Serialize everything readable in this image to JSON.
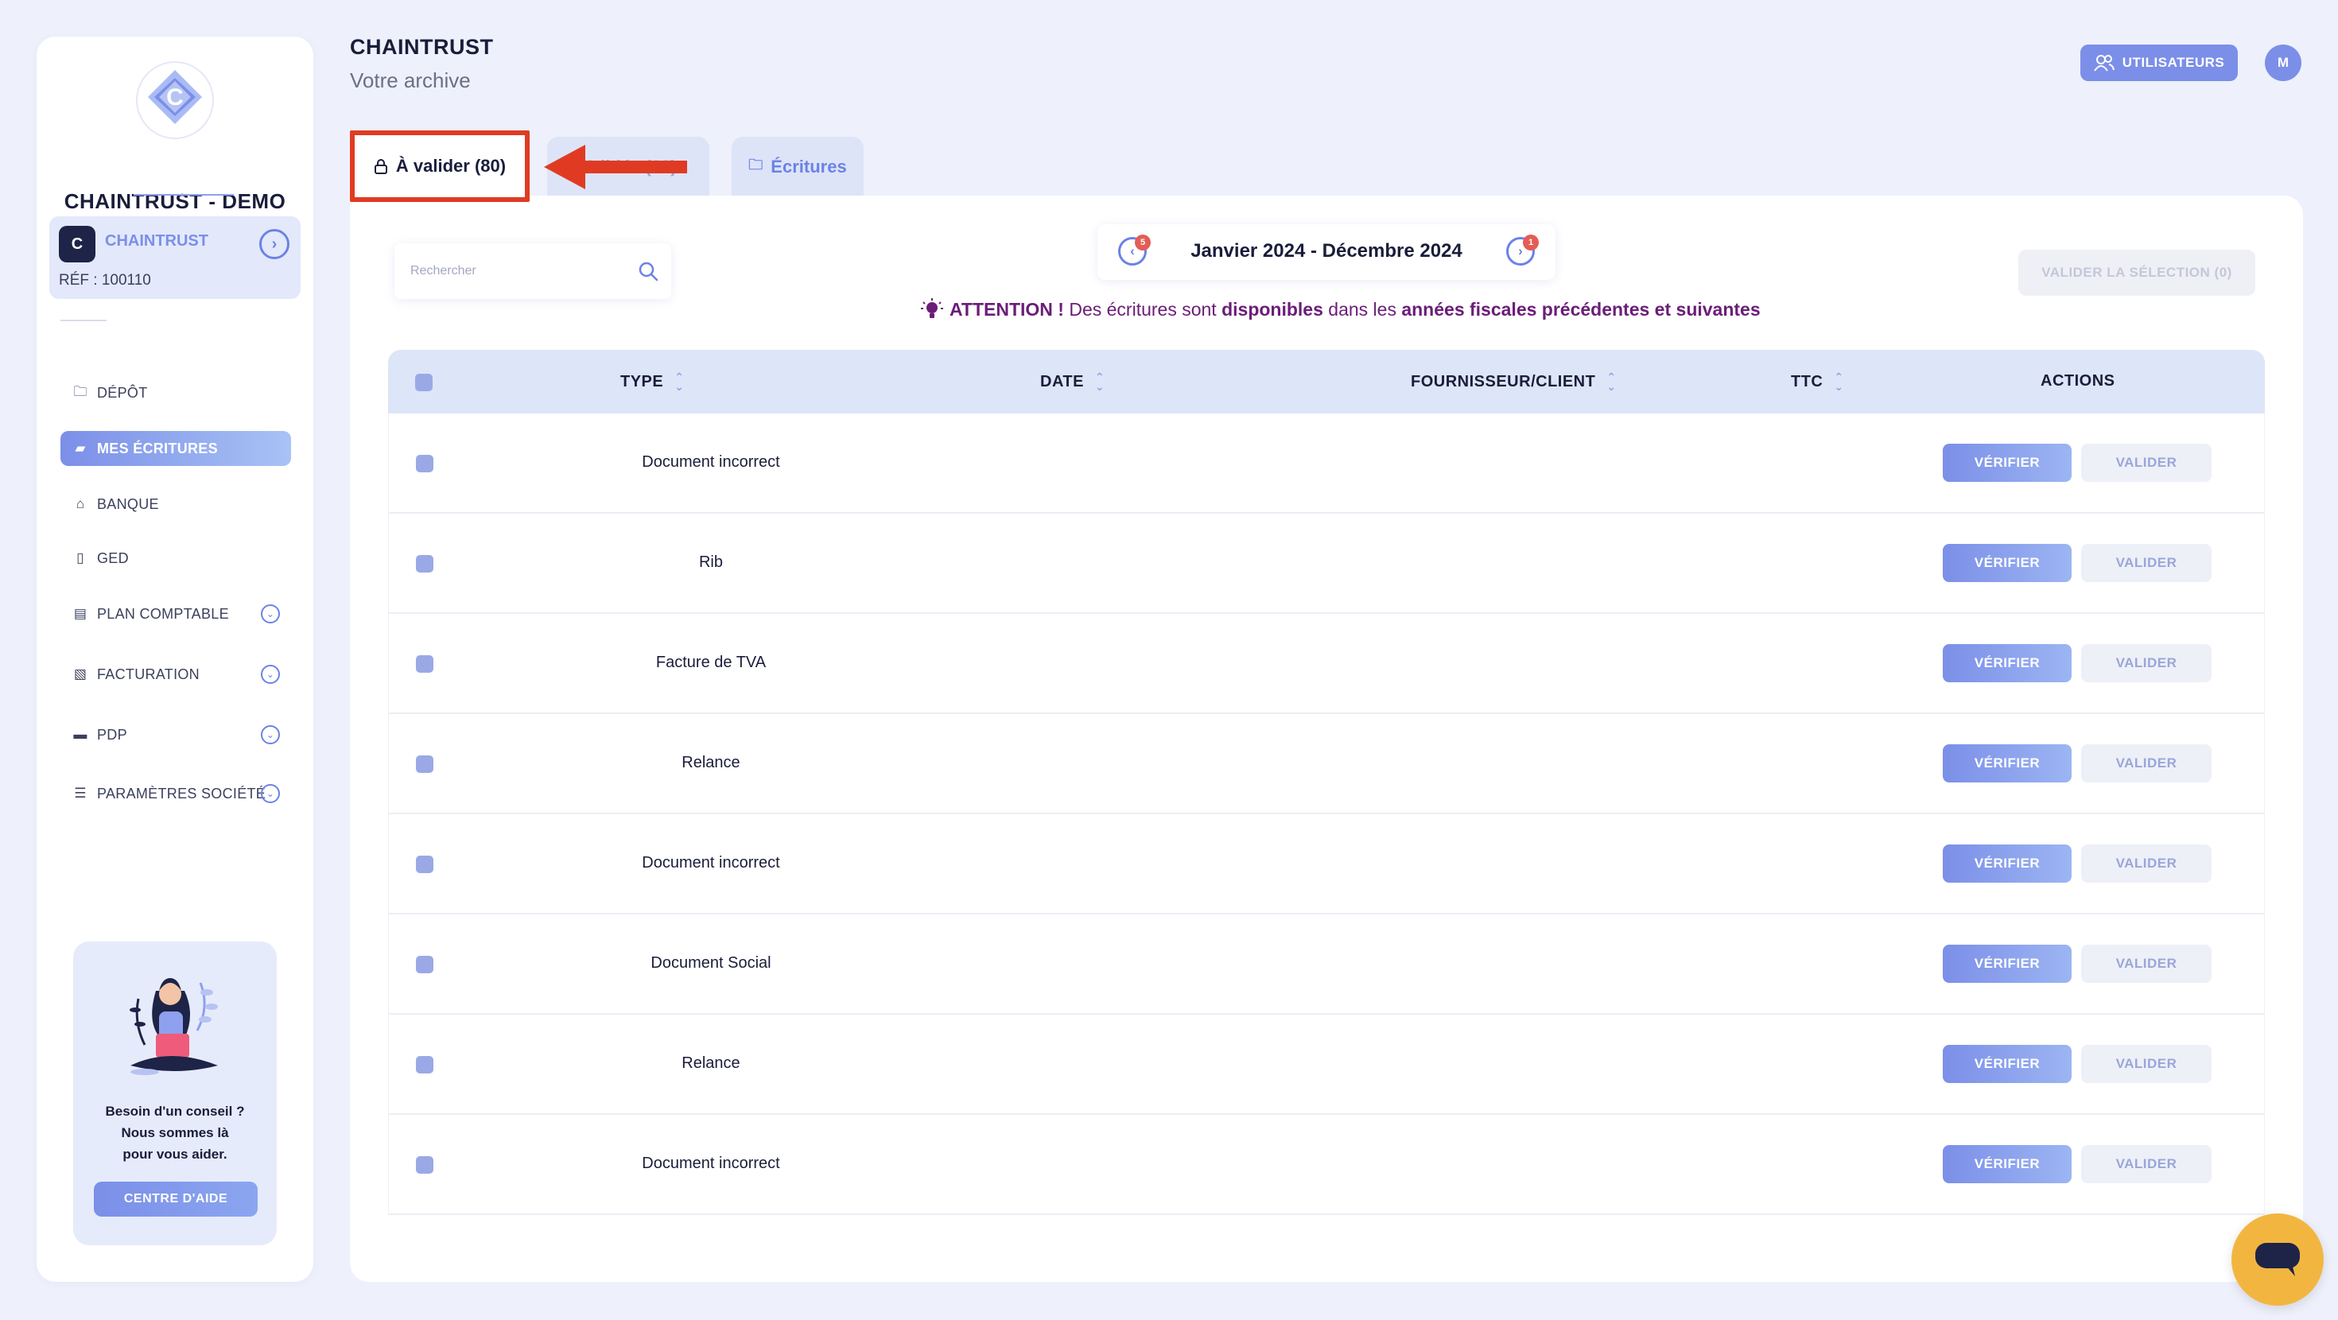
{
  "sidebar": {
    "company_name": "CHAINTRUST - DEMO",
    "company_card": {
      "icon_letter": "C",
      "name": "CHAINTRUST",
      "ref": "RÉF : 100110"
    },
    "nav": [
      {
        "label": "DÉPÔT",
        "icon": "folder-icon",
        "glyph": "🗀",
        "active": false,
        "expandable": false
      },
      {
        "label": "MES ÉCRITURES",
        "icon": "folder-open-icon",
        "glyph": "▰",
        "active": true,
        "expandable": false
      },
      {
        "label": "BANQUE",
        "icon": "bank-icon",
        "glyph": "⌂",
        "active": false,
        "expandable": false
      },
      {
        "label": "GED",
        "icon": "document-search-icon",
        "glyph": "▯",
        "active": false,
        "expandable": false
      },
      {
        "label": "PLAN COMPTABLE",
        "icon": "ledger-icon",
        "glyph": "▤",
        "active": false,
        "expandable": true
      },
      {
        "label": "FACTURATION",
        "icon": "invoice-icon",
        "glyph": "▧",
        "active": false,
        "expandable": true
      },
      {
        "label": "PDP",
        "icon": "card-icon",
        "glyph": "▬",
        "active": false,
        "expandable": true
      },
      {
        "label": "PARAMÈTRES SOCIÉTÉ",
        "icon": "sliders-icon",
        "glyph": "☰",
        "active": false,
        "expandable": true
      }
    ],
    "help": {
      "line1": "Besoin d'un conseil ?",
      "line2": "Nous sommes là",
      "line3": "pour vous aider.",
      "button": "CENTRE D'AIDE"
    }
  },
  "header": {
    "title": "CHAINTRUST",
    "subtitle": "Votre archive",
    "users_button": "UTILISATEURS",
    "avatar_initial": "M"
  },
  "tabs": {
    "to_validate": "À valider (80)",
    "validated": "Validés (80)",
    "entries": "Écritures"
  },
  "toolbar": {
    "search_placeholder": "Rechercher",
    "period_label": "Janvier 2024 - Décembre 2024",
    "prev_badge": "5",
    "next_badge": "1",
    "validate_selection": "VALIDER LA SÉLECTION (0)"
  },
  "attention": {
    "strong1": "ATTENTION !",
    "text1": " Des écritures sont ",
    "strong2": "disponibles",
    "text2": " dans les ",
    "strong3": "années fiscales précédentes et suivantes"
  },
  "table": {
    "headers": {
      "type": "TYPE",
      "date": "DATE",
      "supplier": "FOURNISSEUR/CLIENT",
      "ttc": "TTC",
      "actions": "ACTIONS"
    },
    "verify_label": "VÉRIFIER",
    "validate_label": "VALIDER",
    "rows": [
      {
        "type": "Document incorrect"
      },
      {
        "type": "Rib"
      },
      {
        "type": "Facture de TVA"
      },
      {
        "type": "Relance"
      },
      {
        "type": "Document incorrect"
      },
      {
        "type": "Document Social"
      },
      {
        "type": "Relance"
      },
      {
        "type": "Document incorrect"
      }
    ]
  },
  "colors": {
    "accent": "#7b8fe8",
    "highlight_border": "#e03b22",
    "attention_text": "#6b1d78",
    "chat_button": "#f2b640"
  }
}
